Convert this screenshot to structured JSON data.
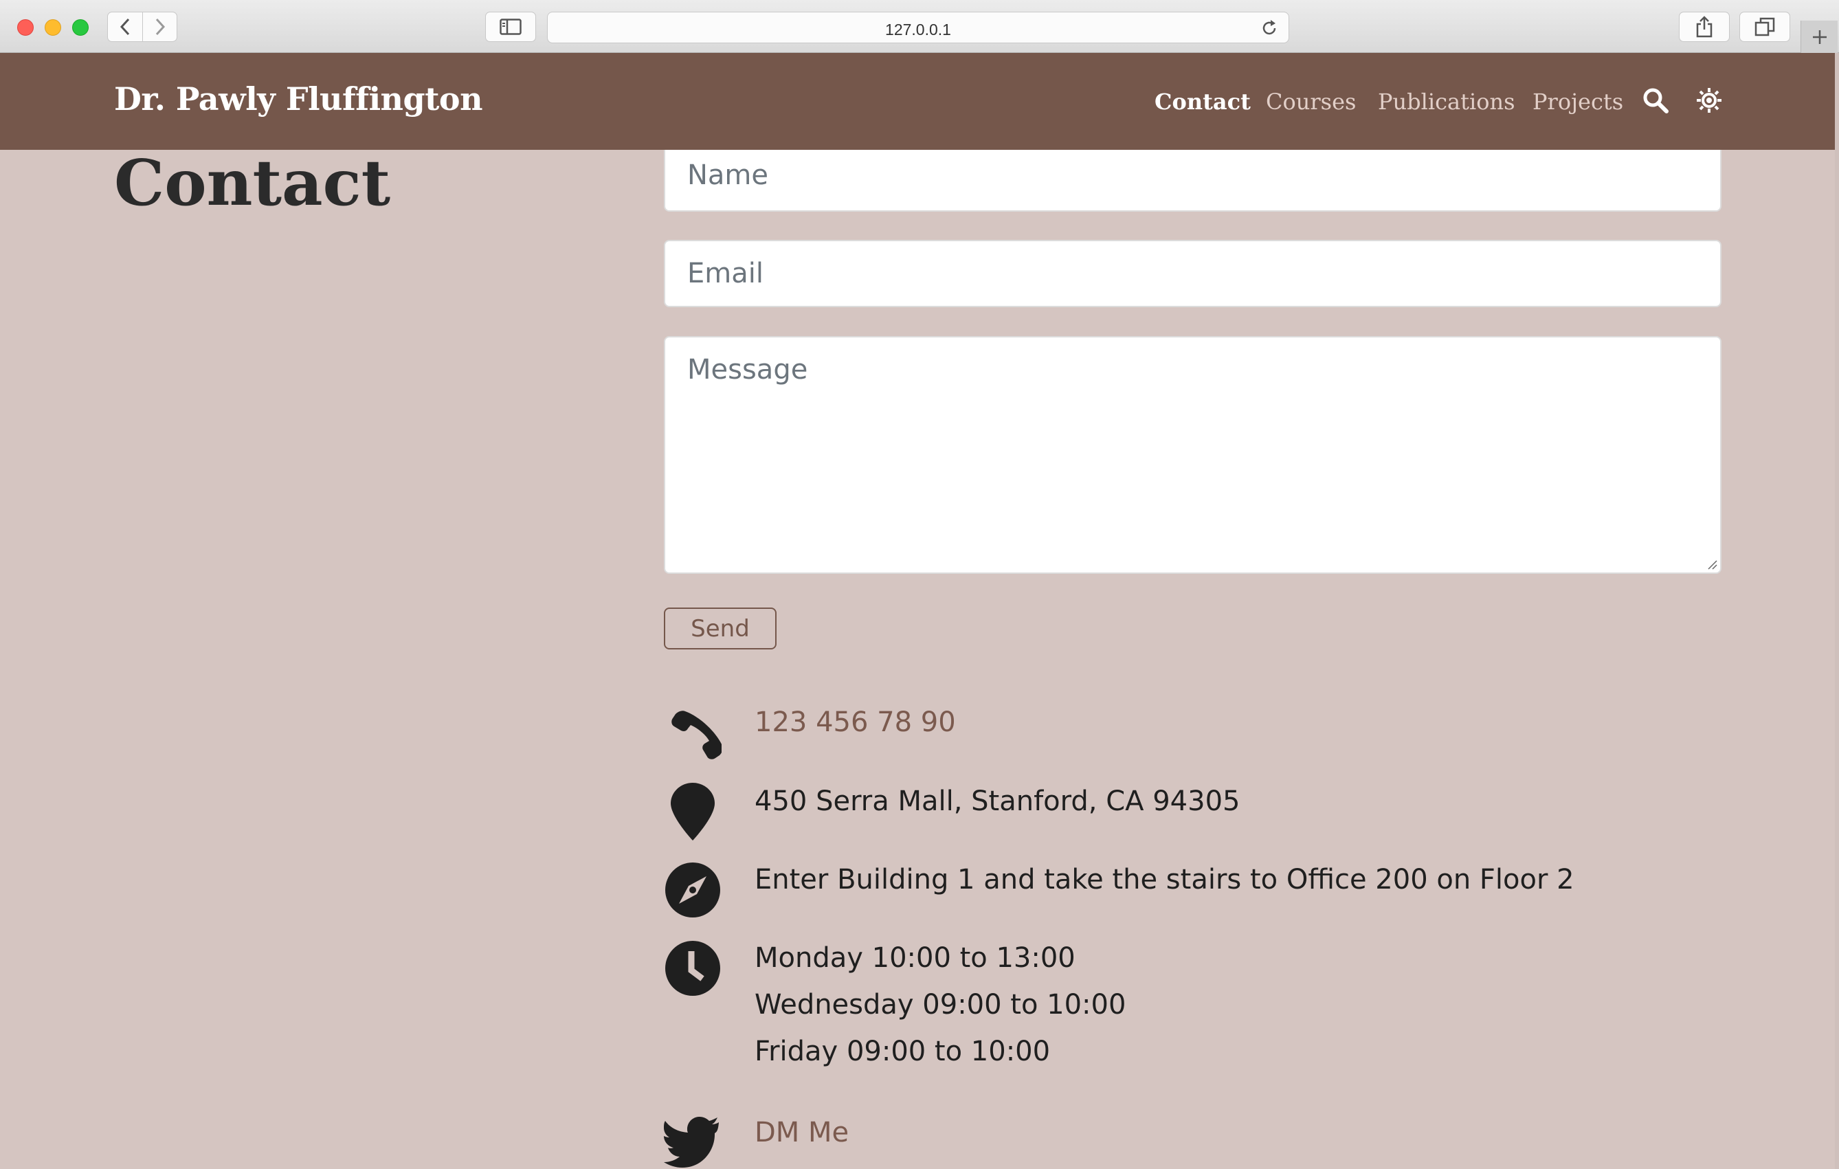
{
  "browser": {
    "url": "127.0.0.1"
  },
  "site": {
    "brand": "Dr. Pawly Fluffington",
    "nav": [
      {
        "label": "Contact"
      },
      {
        "label": "Courses"
      },
      {
        "label": "Publications"
      },
      {
        "label": "Projects"
      }
    ],
    "icons": [
      "search-icon",
      "theme-toggle-icon"
    ]
  },
  "page": {
    "title": "Contact",
    "form": {
      "name_placeholder": "Name",
      "email_placeholder": "Email",
      "message_placeholder": "Message",
      "send_label": "Send"
    },
    "contact": {
      "phone": "123 456 78 90",
      "address": "450 Serra Mall, Stanford, CA 94305",
      "directions": "Enter Building 1 and take the stairs to Office 200 on Floor 2",
      "hours": [
        "Monday 10:00 to 13:00",
        "Wednesday 09:00 to 10:00",
        "Friday 09:00 to 10:00"
      ],
      "twitter": "DM Me"
    }
  },
  "colors": {
    "navbar": "#75574b",
    "background": "#d5c5c1",
    "link": "#7b5a4e"
  }
}
